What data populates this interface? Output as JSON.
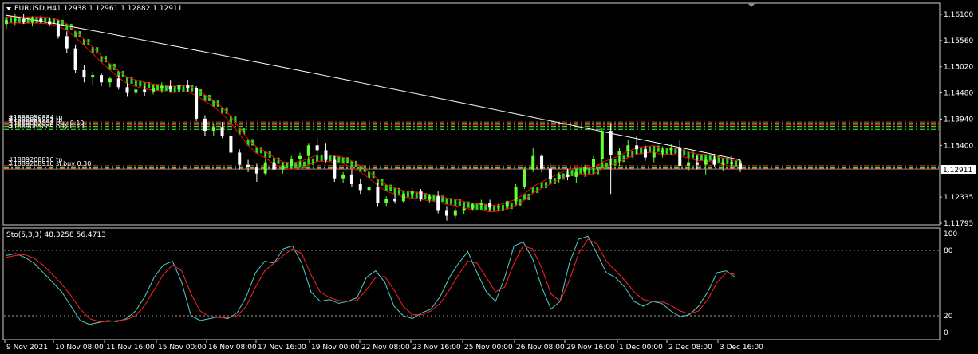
{
  "header": {
    "symbol_label": "EURUSD,H4",
    "ohlc": "1.12938 1.12961 1.12882 1.12911"
  },
  "price_axis": {
    "ticks": [
      "1.16100",
      "1.15560",
      "1.15020",
      "1.14480",
      "1.13940",
      "1.13400",
      "1.12335",
      "1.11795"
    ],
    "current_price": "1.12911"
  },
  "indicator": {
    "label": "Sto(5,3,3) 48.3258 56.4713",
    "levels": [
      "100",
      "80",
      "20",
      "0"
    ]
  },
  "time_axis": {
    "labels": [
      "9 Nov 2021",
      "10 Nov 08:00",
      "11 Nov 16:00",
      "15 Nov 00:00",
      "16 Nov 08:00",
      "17 Nov 16:00",
      "19 Nov 00:00",
      "22 Nov 08:00",
      "23 Nov 16:00",
      "25 Nov 00:00",
      "26 Nov 08:00",
      "29 Nov 16:00",
      "1 Dec 00:00",
      "2 Dec 08:00",
      "3 Dec 16:00"
    ]
  },
  "order_tags": {
    "upper": [
      "#1888050884 tp",
      "#1888061231 tp",
      "#1889087858 buy 0.10",
      "#1889085889 buy 0.10"
    ],
    "lower": [
      "#1889208810 tp",
      "#1889208910 sl buy 0.30"
    ]
  },
  "colors": {
    "background": "#000000",
    "bull_candle": "#66ff33",
    "bear_candle": "#ffffff",
    "ma_band_outer": "#ff0000",
    "ma_band_inner": "#22dd22",
    "slow_ma": "#ffffff",
    "stoch_main": "#55cccc",
    "stoch_signal": "#ff2222",
    "tp_line": "#ff3333",
    "entry_line": "#33ff33"
  },
  "chart_data": {
    "type": "candlestick",
    "timeframe": "H4",
    "ylim": [
      1.1175,
      1.1625
    ],
    "candles": [
      [
        1.159,
        1.1605,
        1.158,
        1.1598
      ],
      [
        1.1598,
        1.1612,
        1.1588,
        1.16
      ],
      [
        1.16,
        1.161,
        1.159,
        1.1595
      ],
      [
        1.1595,
        1.1606,
        1.1585,
        1.1601
      ],
      [
        1.1601,
        1.1608,
        1.159,
        1.1596
      ],
      [
        1.1596,
        1.1604,
        1.1585,
        1.159
      ],
      [
        1.159,
        1.1598,
        1.156,
        1.1565
      ],
      [
        1.1565,
        1.1575,
        1.153,
        1.154
      ],
      [
        1.154,
        1.1548,
        1.149,
        1.1495
      ],
      [
        1.1495,
        1.1505,
        1.147,
        1.148
      ],
      [
        1.148,
        1.1492,
        1.1465,
        1.1485
      ],
      [
        1.1485,
        1.149,
        1.1462,
        1.147
      ],
      [
        1.147,
        1.1482,
        1.146,
        1.1478
      ],
      [
        1.1478,
        1.1484,
        1.1455,
        1.146
      ],
      [
        1.146,
        1.1468,
        1.144,
        1.1448
      ],
      [
        1.1448,
        1.146,
        1.144,
        1.1455
      ],
      [
        1.1455,
        1.1462,
        1.1442,
        1.145
      ],
      [
        1.145,
        1.1465,
        1.1445,
        1.1458
      ],
      [
        1.1458,
        1.147,
        1.1448,
        1.1462
      ],
      [
        1.1462,
        1.1475,
        1.145,
        1.1455
      ],
      [
        1.1455,
        1.147,
        1.1445,
        1.1465
      ],
      [
        1.1465,
        1.1475,
        1.145,
        1.1458
      ],
      [
        1.1458,
        1.1462,
        1.139,
        1.1395
      ],
      [
        1.1395,
        1.1402,
        1.136,
        1.137
      ],
      [
        1.137,
        1.1385,
        1.136,
        1.1378
      ],
      [
        1.1378,
        1.1388,
        1.1355,
        1.136
      ],
      [
        1.136,
        1.1368,
        1.132,
        1.1325
      ],
      [
        1.1325,
        1.1332,
        1.129,
        1.13
      ],
      [
        1.13,
        1.131,
        1.1285,
        1.1295
      ],
      [
        1.1295,
        1.1302,
        1.1265,
        1.1282
      ],
      [
        1.1282,
        1.1312,
        1.128,
        1.1305
      ],
      [
        1.1305,
        1.1312,
        1.1285,
        1.129
      ],
      [
        1.129,
        1.1305,
        1.1282,
        1.1298
      ],
      [
        1.1298,
        1.1318,
        1.1292,
        1.1312
      ],
      [
        1.1312,
        1.1325,
        1.13,
        1.1318
      ],
      [
        1.1318,
        1.1345,
        1.1312,
        1.134
      ],
      [
        1.134,
        1.1355,
        1.132,
        1.133
      ],
      [
        1.133,
        1.1345,
        1.1305,
        1.131
      ],
      [
        1.131,
        1.1318,
        1.1265,
        1.1272
      ],
      [
        1.1272,
        1.1285,
        1.1262,
        1.128
      ],
      [
        1.128,
        1.129,
        1.1255,
        1.126
      ],
      [
        1.126,
        1.127,
        1.124,
        1.1248
      ],
      [
        1.1248,
        1.126,
        1.1238,
        1.1255
      ],
      [
        1.1255,
        1.1262,
        1.1215,
        1.1222
      ],
      [
        1.1222,
        1.1235,
        1.1215,
        1.123
      ],
      [
        1.123,
        1.124,
        1.122,
        1.1225
      ],
      [
        1.1225,
        1.1242,
        1.1222,
        1.124
      ],
      [
        1.124,
        1.1255,
        1.1235,
        1.1245
      ],
      [
        1.1245,
        1.125,
        1.1225,
        1.123
      ],
      [
        1.123,
        1.124,
        1.1222,
        1.1235
      ],
      [
        1.1235,
        1.1245,
        1.12,
        1.1205
      ],
      [
        1.1205,
        1.1215,
        1.1185,
        1.1195
      ],
      [
        1.1195,
        1.121,
        1.1188,
        1.1205
      ],
      [
        1.1205,
        1.1215,
        1.1198,
        1.121
      ],
      [
        1.121,
        1.1222,
        1.1205,
        1.1218
      ],
      [
        1.1218,
        1.1228,
        1.121,
        1.1222
      ],
      [
        1.1222,
        1.1228,
        1.1208,
        1.1212
      ],
      [
        1.1212,
        1.122,
        1.1205,
        1.1215
      ],
      [
        1.1215,
        1.1228,
        1.121,
        1.1225
      ],
      [
        1.1225,
        1.126,
        1.122,
        1.1255
      ],
      [
        1.1255,
        1.1295,
        1.125,
        1.129
      ],
      [
        1.129,
        1.1335,
        1.1285,
        1.1318
      ],
      [
        1.1318,
        1.1322,
        1.1285,
        1.1292
      ],
      [
        1.1292,
        1.13,
        1.1262,
        1.127
      ],
      [
        1.127,
        1.1285,
        1.1262,
        1.128
      ],
      [
        1.128,
        1.1292,
        1.1268,
        1.1275
      ],
      [
        1.1275,
        1.129,
        1.1262,
        1.1285
      ],
      [
        1.1285,
        1.13,
        1.1275,
        1.1295
      ],
      [
        1.1295,
        1.1318,
        1.129,
        1.1312
      ],
      [
        1.1312,
        1.1375,
        1.1305,
        1.137
      ],
      [
        1.137,
        1.1385,
        1.124,
        1.132
      ],
      [
        1.132,
        1.1335,
        1.1298,
        1.1328
      ],
      [
        1.1328,
        1.1352,
        1.1318,
        1.134
      ],
      [
        1.134,
        1.136,
        1.1322,
        1.1332
      ],
      [
        1.1332,
        1.134,
        1.1308,
        1.1315
      ],
      [
        1.1315,
        1.133,
        1.1305,
        1.1325
      ],
      [
        1.1325,
        1.1338,
        1.1315,
        1.133
      ],
      [
        1.133,
        1.1342,
        1.132,
        1.1335
      ],
      [
        1.1335,
        1.135,
        1.129,
        1.1298
      ],
      [
        1.1298,
        1.1312,
        1.1288,
        1.1305
      ],
      [
        1.1305,
        1.1318,
        1.129,
        1.13
      ],
      [
        1.13,
        1.1315,
        1.128,
        1.131
      ],
      [
        1.131,
        1.1322,
        1.1295,
        1.13
      ],
      [
        1.13,
        1.131,
        1.1288,
        1.1305
      ],
      [
        1.1305,
        1.1318,
        1.1292,
        1.1302
      ],
      [
        1.1302,
        1.131,
        1.1285,
        1.1291
      ]
    ],
    "stochastic": {
      "main": [
        78,
        80,
        76,
        70,
        60,
        50,
        40,
        25,
        10,
        6,
        8,
        10,
        9,
        12,
        20,
        35,
        55,
        68,
        72,
        50,
        15,
        10,
        12,
        14,
        12,
        18,
        35,
        60,
        72,
        70,
        85,
        88,
        70,
        40,
        30,
        32,
        28,
        30,
        34,
        55,
        62,
        50,
        25,
        15,
        12,
        18,
        22,
        35,
        55,
        70,
        82,
        60,
        40,
        30,
        55,
        88,
        92,
        75,
        45,
        22,
        30,
        70,
        95,
        98,
        80,
        60,
        55,
        45,
        30,
        25,
        30,
        28,
        20,
        14,
        16,
        25,
        40,
        60,
        62,
        55
      ],
      "signal": [
        76,
        78,
        79,
        75,
        68,
        58,
        48,
        36,
        22,
        12,
        9,
        9,
        10,
        11,
        15,
        26,
        42,
        58,
        68,
        62,
        38,
        20,
        14,
        13,
        13,
        15,
        25,
        45,
        62,
        70,
        78,
        85,
        80,
        58,
        40,
        34,
        31,
        30,
        31,
        42,
        55,
        56,
        42,
        25,
        16,
        16,
        20,
        28,
        42,
        58,
        72,
        70,
        55,
        40,
        45,
        70,
        88,
        85,
        65,
        38,
        30,
        52,
        80,
        95,
        90,
        72,
        62,
        52,
        40,
        32,
        30,
        30,
        26,
        20,
        17,
        20,
        32,
        50,
        60,
        58
      ]
    }
  }
}
